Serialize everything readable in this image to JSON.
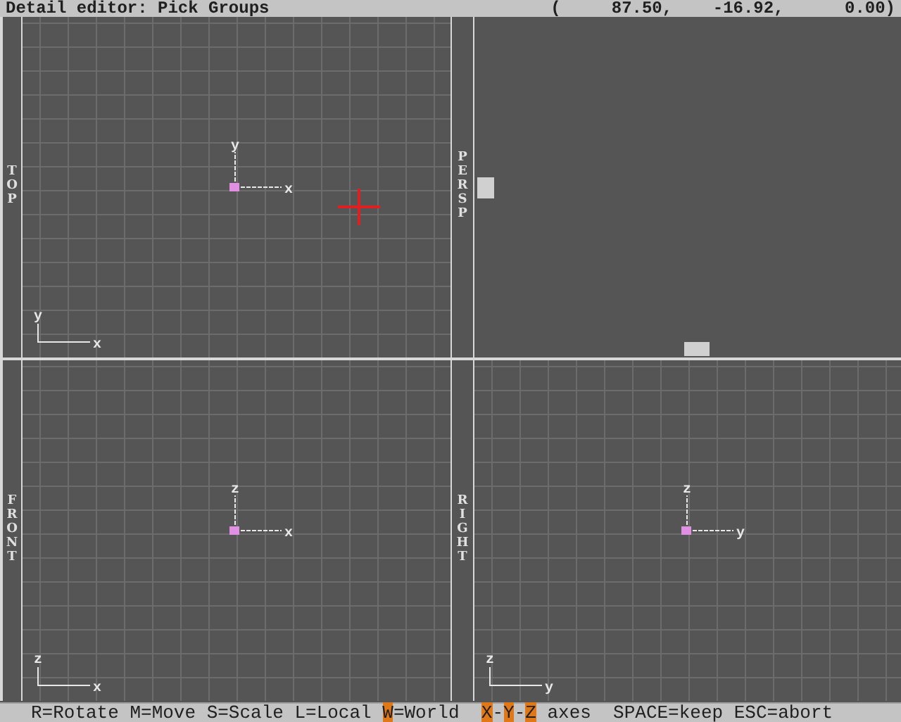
{
  "title_bar": {
    "title": "Detail editor: Pick Groups",
    "coordinates": "(     87.50,    -16.92,      0.00)"
  },
  "viewports": [
    {
      "label": "TOP",
      "kind": "ortho",
      "grid": true,
      "cursor": true,
      "gizmo": {
        "up": "y",
        "right": "x"
      },
      "corner_axes": {
        "up": "y",
        "right": "x"
      }
    },
    {
      "label": "PERSP",
      "kind": "perspective",
      "grid": false,
      "cursor": false
    },
    {
      "label": "FRONT",
      "kind": "ortho",
      "grid": true,
      "cursor": false,
      "gizmo": {
        "up": "z",
        "right": "x"
      },
      "corner_axes": {
        "up": "z",
        "right": "x"
      }
    },
    {
      "label": "RIGHT",
      "kind": "ortho",
      "grid": true,
      "cursor": false,
      "gizmo": {
        "up": "z",
        "right": "y"
      },
      "corner_axes": {
        "up": "z",
        "right": "y"
      }
    }
  ],
  "status_bar": [
    {
      "text": "R=Rotate M=Move S=Scale L=Local ",
      "highlighted": false
    },
    {
      "text": "W",
      "highlighted": true
    },
    {
      "text": "=World  ",
      "highlighted": false
    },
    {
      "text": "X",
      "highlighted": true
    },
    {
      "text": "-",
      "highlighted": false
    },
    {
      "text": "Y",
      "highlighted": true
    },
    {
      "text": "-",
      "highlighted": false
    },
    {
      "text": "Z",
      "highlighted": true
    },
    {
      "text": " axes  SPACE=keep ESC=abort",
      "highlighted": false
    }
  ]
}
